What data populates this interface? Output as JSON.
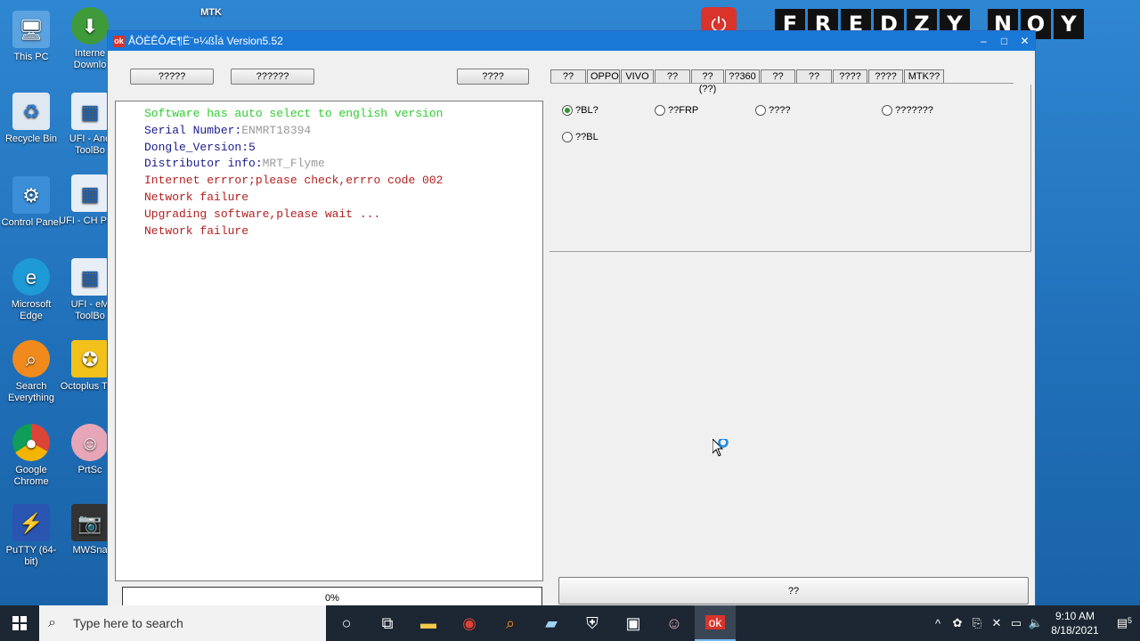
{
  "desktop": {
    "icons": [
      {
        "label": "This PC"
      },
      {
        "label": "Recycle Bin"
      },
      {
        "label": "Control Panel"
      },
      {
        "label": "Microsoft Edge"
      },
      {
        "label": "Search Everything"
      },
      {
        "label": "Google Chrome"
      },
      {
        "label": "PuTTY (64-bit)"
      },
      {
        "label": "Interne Downlo"
      },
      {
        "label": "UFI - And ToolBo"
      },
      {
        "label": "UFI - CH Prog"
      },
      {
        "label": "UFI - eM ToolBo"
      },
      {
        "label": "Octoplus Tool"
      },
      {
        "label": "PrtSc"
      },
      {
        "label": "MWSna"
      },
      {
        "label": "MTK"
      }
    ],
    "banner_letters": [
      "F",
      "R",
      "E",
      "D",
      "Z",
      "Y",
      "",
      "N",
      "O",
      "Y"
    ]
  },
  "window": {
    "title": "ÅÖÈÊÔÆ¶Ë¨¤¼ßÎá Version5.52",
    "minimize": "–",
    "maximize": "□",
    "close": "✕",
    "toolbar": {
      "btn1": "?????",
      "btn2": "??????",
      "btn3": "????"
    },
    "log": [
      {
        "k": "Software has auto select to english version",
        "v": "",
        "cls": "green"
      },
      {
        "k": "Serial Number:",
        "v": "ENMRT18394",
        "cls": "k"
      },
      {
        "k": "Dongle_Version:5",
        "v": "",
        "cls": "k"
      },
      {
        "k": "Distributor info:",
        "v": "MRT_Flyme",
        "cls": "k"
      },
      {
        "k": "Internet errror;please check,errro code 002",
        "v": "",
        "cls": "red"
      },
      {
        "k": "Network failure",
        "v": "",
        "cls": "red"
      },
      {
        "k": "Upgrading software,please wait ...",
        "v": "",
        "cls": "red"
      },
      {
        "k": "Network failure",
        "v": "",
        "cls": "red"
      }
    ],
    "progress": "0%",
    "tabs": [
      "??",
      "OPPO",
      "VIVO",
      "??",
      "??(??)",
      "??360",
      "??",
      "??",
      "????",
      "????",
      "MTK??"
    ],
    "radios": [
      {
        "label": "?BL?",
        "checked": true
      },
      {
        "label": "??FRP",
        "checked": false
      },
      {
        "label": "????",
        "checked": false
      },
      {
        "label": "???????",
        "checked": false
      },
      {
        "label": "??BL",
        "checked": false
      }
    ],
    "action_button": "??"
  },
  "taskbar": {
    "search_placeholder": "Type here to search",
    "time": "9:10 AM",
    "date": "8/18/2021",
    "notification_count": "5"
  }
}
